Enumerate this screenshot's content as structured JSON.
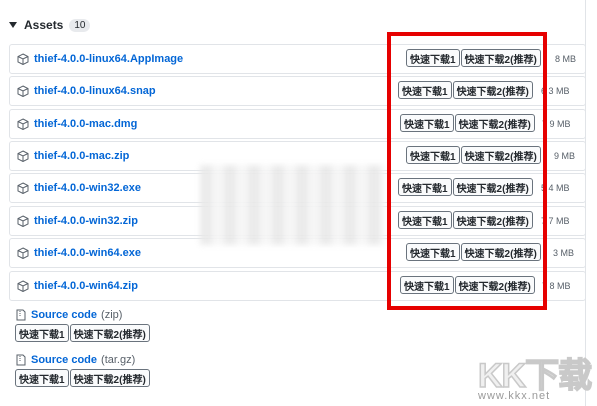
{
  "assets": {
    "title": "Assets",
    "count": "10",
    "items": [
      {
        "name": "thief-4.0.0-linux64.AppImage",
        "btn1": "快速下载1",
        "btn2": "快速下载2(推荐)",
        "size": "8 MB"
      },
      {
        "name": "thief-4.0.0-linux64.snap",
        "btn1": "快速下载1",
        "btn2": "快速下载2(推荐)",
        "size": "6 3 MB"
      },
      {
        "name": "thief-4.0.0-mac.dmg",
        "btn1": "快速下载1",
        "btn2": "快速下载2(推荐)",
        "size": "7 9 MB"
      },
      {
        "name": "thief-4.0.0-mac.zip",
        "btn1": "快速下载1",
        "btn2": "快速下载2(推荐)",
        "size": "9 MB"
      },
      {
        "name": "thief-4.0.0-win32.exe",
        "btn1": "快速下载1",
        "btn2": "快速下载2(推荐)",
        "size": "5 4 MB"
      },
      {
        "name": "thief-4.0.0-win32.zip",
        "btn1": "快速下载1",
        "btn2": "快速下载2(推荐)",
        "size": "7 7 MB"
      },
      {
        "name": "thief-4.0.0-win64.exe",
        "btn1": "快速下载1",
        "btn2": "快速下载2(推荐)",
        "size": "3 MB"
      },
      {
        "name": "thief-4.0.0-win64.zip",
        "btn1": "快速下载1",
        "btn2": "快速下载2(推荐)",
        "size": "7 8 MB"
      }
    ],
    "sources": [
      {
        "label": "Source code",
        "ext": "(zip)",
        "btn1": "快速下载1",
        "btn2": "快速下载2(推荐)"
      },
      {
        "label": "Source code",
        "ext": "(tar.gz)",
        "btn1": "快速下载1",
        "btn2": "快速下载2(推荐)"
      }
    ]
  },
  "watermark": {
    "logo": "KK下载",
    "url": "www.kkx.net"
  },
  "colors": {
    "link": "#0366d6",
    "highlight": "#e60000"
  }
}
